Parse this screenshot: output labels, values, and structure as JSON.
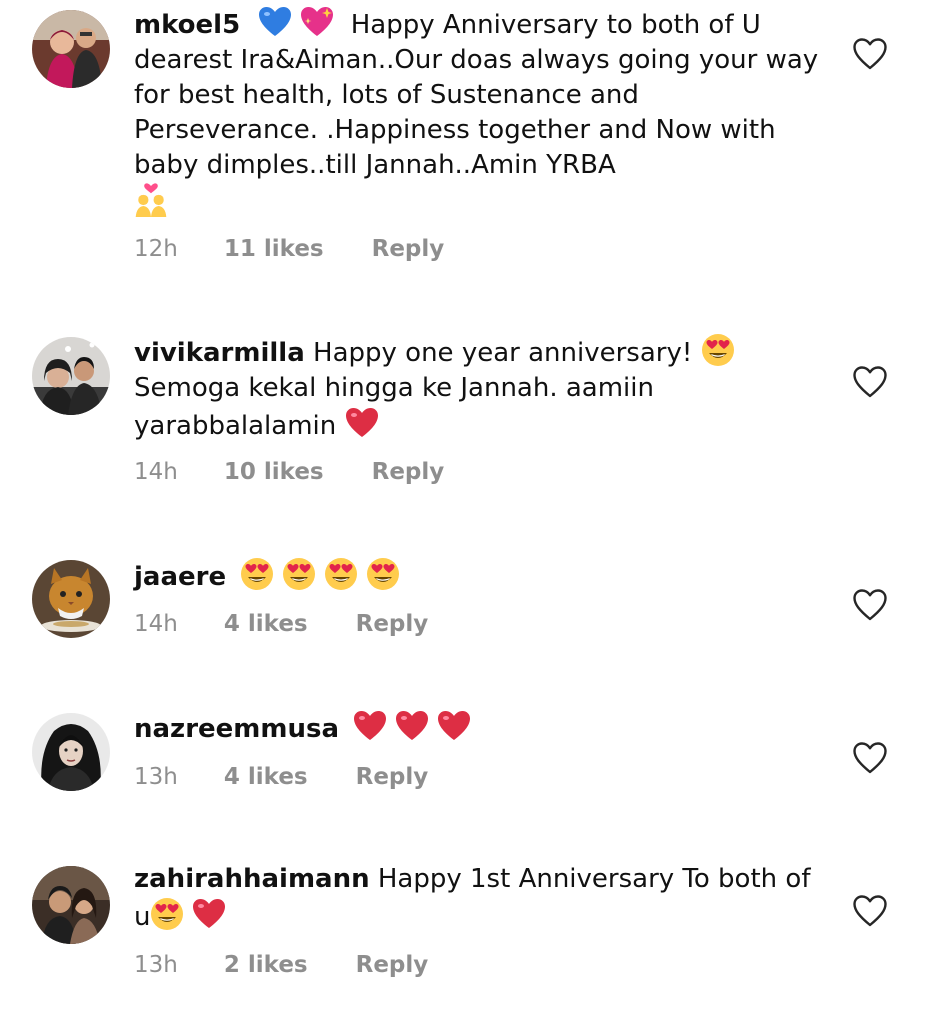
{
  "comments": [
    {
      "username": "mkoel5",
      "lead_emojis": [
        "blue-heart",
        "sparkling-heart"
      ],
      "text": " Happy Anniversary to both of U dearest Ira&Aiman..Our doas always going your way for best health, lots of Sustenance and Perseverance. .Happiness together and Now with baby dimples..till Jannah..Amin YRBA",
      "trail_emojis": [
        "couple-with-heart"
      ],
      "time": "12h",
      "likes": "11 likes",
      "reply": "Reply"
    },
    {
      "username": "vivikarmilla",
      "text": " Happy one year anniversary! ",
      "mid_emojis": [
        "heart-eyes"
      ],
      "text2": " Semoga kekal hingga ke Jannah. aamiin yarabbalalamin ",
      "trail_emojis": [
        "red-heart"
      ],
      "time": "14h",
      "likes": "10 likes",
      "reply": "Reply"
    },
    {
      "username": "jaaere",
      "trail_emojis": [
        "heart-eyes",
        "heart-eyes",
        "heart-eyes",
        "heart-eyes"
      ],
      "time": "14h",
      "likes": "4 likes",
      "reply": "Reply"
    },
    {
      "username": "nazreemmusa",
      "trail_emojis": [
        "red-heart",
        "red-heart",
        "red-heart"
      ],
      "time": "13h",
      "likes": "4 likes",
      "reply": "Reply"
    },
    {
      "username": "zahirahhaimann",
      "text": " Happy 1st Anniversary To both of u",
      "trail_emojis": [
        "heart-eyes",
        "red-heart"
      ],
      "time": "13h",
      "likes": "2 likes",
      "reply": "Reply"
    }
  ],
  "colors": {
    "meta_gray": "#8e8e8e",
    "text": "#111111",
    "heart_outline": "#262626"
  },
  "icons": {
    "like": "heart-outline-icon"
  }
}
